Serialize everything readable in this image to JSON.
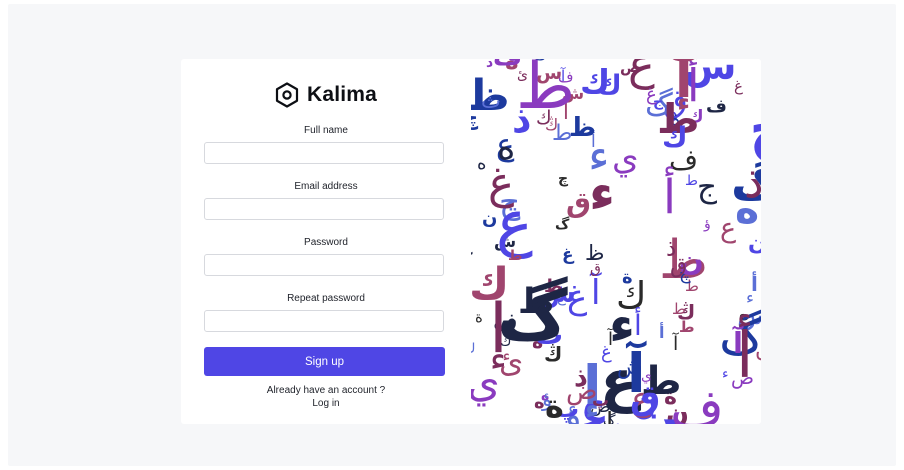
{
  "brand": {
    "name": "Kalima",
    "icon": "hexagon-logo-icon"
  },
  "form": {
    "full_name": {
      "label": "Full name",
      "value": "",
      "placeholder": ""
    },
    "email": {
      "label": "Email address",
      "value": "",
      "placeholder": ""
    },
    "password": {
      "label": "Password",
      "value": "",
      "placeholder": ""
    },
    "repeat_password": {
      "label": "Repeat password",
      "value": "",
      "placeholder": ""
    },
    "submit_label": "Sign up",
    "account_prompt": "Already have an account ?",
    "login_label": "Log in"
  },
  "colors": {
    "primary": "#4f46e5",
    "page_bg": "#f6f7f9",
    "art_palette": [
      "#1e2645",
      "#7b2d5c",
      "#a0456e",
      "#4f46e5",
      "#1d3a9e",
      "#5b6fd6",
      "#8a3bbf",
      "#2a2a2a"
    ]
  },
  "art": {
    "description": "Decorative pattern of Arabic letters",
    "glyphs": [
      "ط",
      "ي",
      "غ",
      "ن",
      "ك",
      "ف",
      "ة",
      "ق",
      "آ",
      "ج",
      "ظ",
      "س",
      "ص",
      "ش",
      "ع",
      "ه",
      "ذ",
      "د",
      "ض",
      "پ",
      "ث",
      "گ",
      "ؤ",
      "إ",
      "أ",
      "ء",
      "چ",
      "ڭ",
      "ئ",
      "ي",
      "ط",
      "ك"
    ]
  }
}
